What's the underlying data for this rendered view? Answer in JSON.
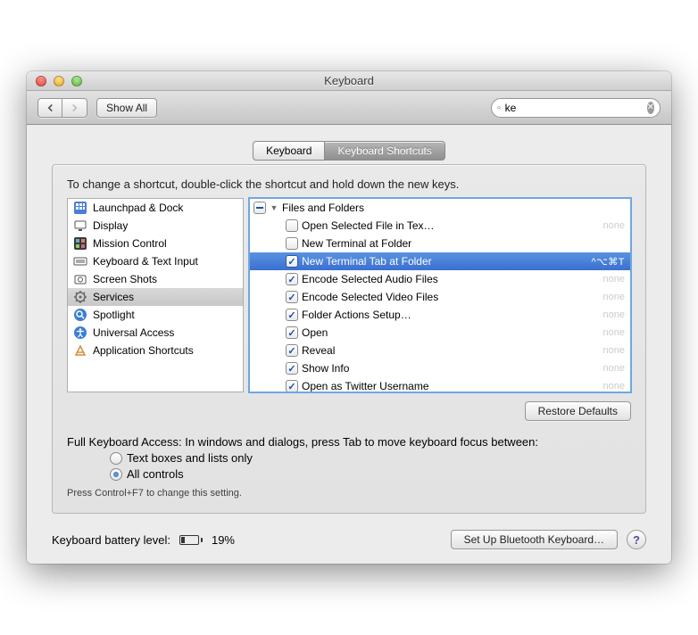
{
  "window": {
    "title": "Keyboard"
  },
  "toolbar": {
    "show_all": "Show All",
    "search_value": "ke"
  },
  "tabs": {
    "keyboard": "Keyboard",
    "shortcuts": "Keyboard Shortcuts"
  },
  "instruction": "To change a shortcut, double-click the shortcut and hold down the new keys.",
  "categories": [
    {
      "label": "Launchpad & Dock",
      "icon": "launchpad"
    },
    {
      "label": "Display",
      "icon": "display"
    },
    {
      "label": "Mission Control",
      "icon": "mission"
    },
    {
      "label": "Keyboard & Text Input",
      "icon": "keyboard"
    },
    {
      "label": "Screen Shots",
      "icon": "screenshot"
    },
    {
      "label": "Services",
      "icon": "gear",
      "selected": true
    },
    {
      "label": "Spotlight",
      "icon": "spotlight"
    },
    {
      "label": "Universal Access",
      "icon": "universal"
    },
    {
      "label": "Application Shortcuts",
      "icon": "app"
    }
  ],
  "group_header": "Files and Folders",
  "services": [
    {
      "checked": false,
      "label": "Open Selected File in Tex…",
      "shortcut": "none"
    },
    {
      "checked": false,
      "label": "New Terminal at Folder",
      "shortcut": ""
    },
    {
      "checked": true,
      "label": "New Terminal Tab at Folder",
      "shortcut": "^⌥⌘T",
      "selected": true
    },
    {
      "checked": true,
      "label": "Encode Selected Audio Files",
      "shortcut": "none"
    },
    {
      "checked": true,
      "label": "Encode Selected Video Files",
      "shortcut": "none"
    },
    {
      "checked": true,
      "label": "Folder Actions Setup…",
      "shortcut": "none"
    },
    {
      "checked": true,
      "label": "Open",
      "shortcut": "none"
    },
    {
      "checked": true,
      "label": "Reveal",
      "shortcut": "none"
    },
    {
      "checked": true,
      "label": "Show Info",
      "shortcut": "none"
    },
    {
      "checked": true,
      "label": "Open as Twitter Username",
      "shortcut": "none"
    }
  ],
  "buttons": {
    "restore": "Restore Defaults",
    "bluetooth": "Set Up Bluetooth Keyboard…"
  },
  "fka": {
    "label": "Full Keyboard Access: In windows and dialogs, press Tab to move keyboard focus between:",
    "opt1": "Text boxes and lists only",
    "opt2": "All controls",
    "hint": "Press Control+F7 to change this setting."
  },
  "battery": {
    "label": "Keyboard battery level:",
    "percent": "19%"
  }
}
